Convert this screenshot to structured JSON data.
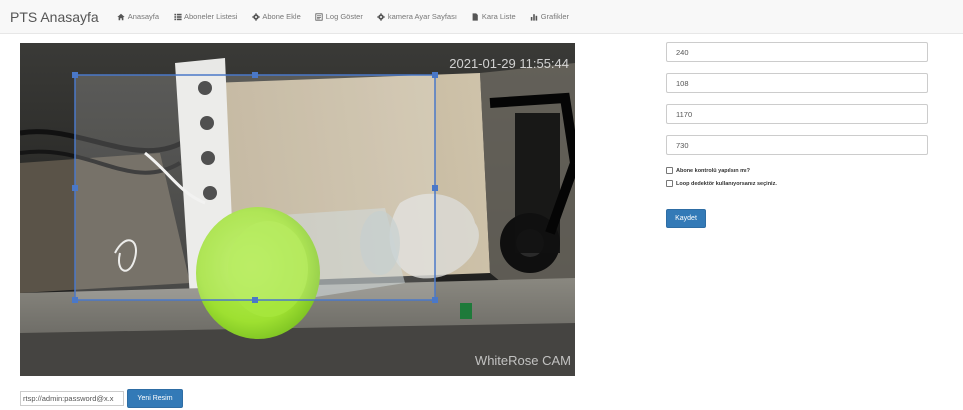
{
  "nav": {
    "brand": "PTS Anasayfa",
    "items": [
      {
        "label": "Anasayfa",
        "icon": "home-icon"
      },
      {
        "label": "Aboneler Listesi",
        "icon": "list-icon"
      },
      {
        "label": "Abone Ekle",
        "icon": "gear-icon"
      },
      {
        "label": "Log Göster",
        "icon": "log-icon"
      },
      {
        "label": "kamera Ayar Sayfası",
        "icon": "gear-icon"
      },
      {
        "label": "Kara Liste",
        "icon": "file-icon"
      },
      {
        "label": "Grafikler",
        "icon": "bar-chart-icon"
      }
    ]
  },
  "camera": {
    "timestamp": "2021-01-29 11:55:44",
    "watermark": "WhiteRose CAM"
  },
  "stream": {
    "url_value": "rtsp://admin:password@x.x",
    "refresh_label": "Yeni Resim"
  },
  "settings": {
    "x_value": "240",
    "y_value": "108",
    "width_value": "1170",
    "height_value": "730",
    "subscriber_check_label": "Abone kontrolü yapılsın mı?",
    "loop_check_label": "Loop dedektör kullanıyorsanız seçiniz.",
    "save_label": "Kaydet"
  },
  "colors": {
    "primary": "#337ab7",
    "selection": "#4a78c8",
    "bottle_cap": "#9ee031"
  }
}
